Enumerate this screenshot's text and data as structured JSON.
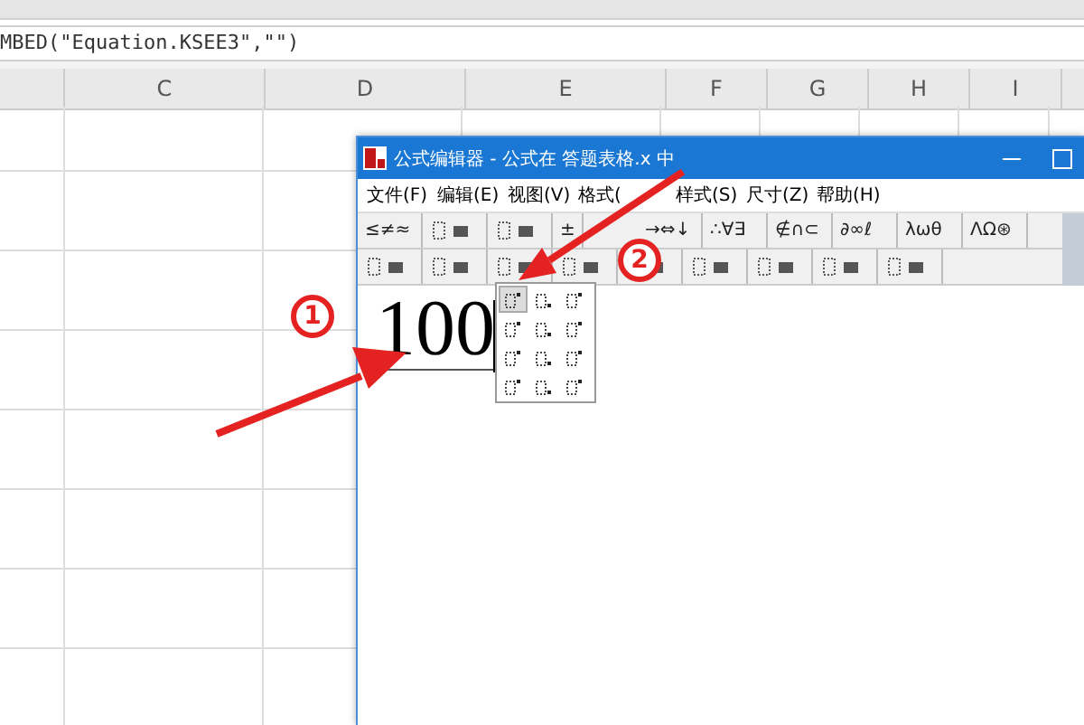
{
  "formula_bar": {
    "text": "MBED(\"Equation.KSEE3\",\"\")"
  },
  "columns": [
    {
      "label": "C"
    },
    {
      "label": "D"
    },
    {
      "label": "E"
    },
    {
      "label": "F"
    },
    {
      "label": "G"
    },
    {
      "label": "H"
    },
    {
      "label": "I"
    }
  ],
  "editor": {
    "title": "公式编辑器 - 公式在 答题表格.x 中",
    "menu": [
      "文件(F)",
      "编辑(E)",
      "视图(V)",
      "格式(",
      "样式(S)",
      "尺寸(Z)",
      "帮助(H)"
    ],
    "toolbar_1": [
      {
        "kind": "text",
        "label": "≤≠≈"
      },
      {
        "kind": "icon"
      },
      {
        "kind": "icon"
      },
      {
        "kind": "text",
        "label": "±"
      },
      {
        "kind": "text",
        "label": "→⇔↓"
      },
      {
        "kind": "text",
        "label": "∴∀∃"
      },
      {
        "kind": "text",
        "label": "∉∩⊂"
      },
      {
        "kind": "text",
        "label": "∂∞ℓ"
      },
      {
        "kind": "text",
        "label": "λωθ"
      },
      {
        "kind": "text",
        "label": "ΛΩ⊛"
      }
    ],
    "toolbar_2": [
      {
        "kind": "icon"
      },
      {
        "kind": "icon"
      },
      {
        "kind": "icon"
      },
      {
        "kind": "icon"
      },
      {
        "kind": "icon"
      },
      {
        "kind": "icon"
      },
      {
        "kind": "icon"
      },
      {
        "kind": "icon"
      },
      {
        "kind": "icon"
      }
    ],
    "equation": "100",
    "palette": [
      {
        "selected": true
      },
      {
        "selected": false
      },
      {
        "selected": false
      },
      {
        "selected": false
      },
      {
        "selected": false
      },
      {
        "selected": false
      },
      {
        "selected": false
      },
      {
        "selected": false
      },
      {
        "selected": false
      },
      {
        "selected": false
      },
      {
        "selected": false
      },
      {
        "selected": false
      }
    ]
  },
  "callouts": [
    {
      "label": "1"
    },
    {
      "label": "2"
    }
  ]
}
